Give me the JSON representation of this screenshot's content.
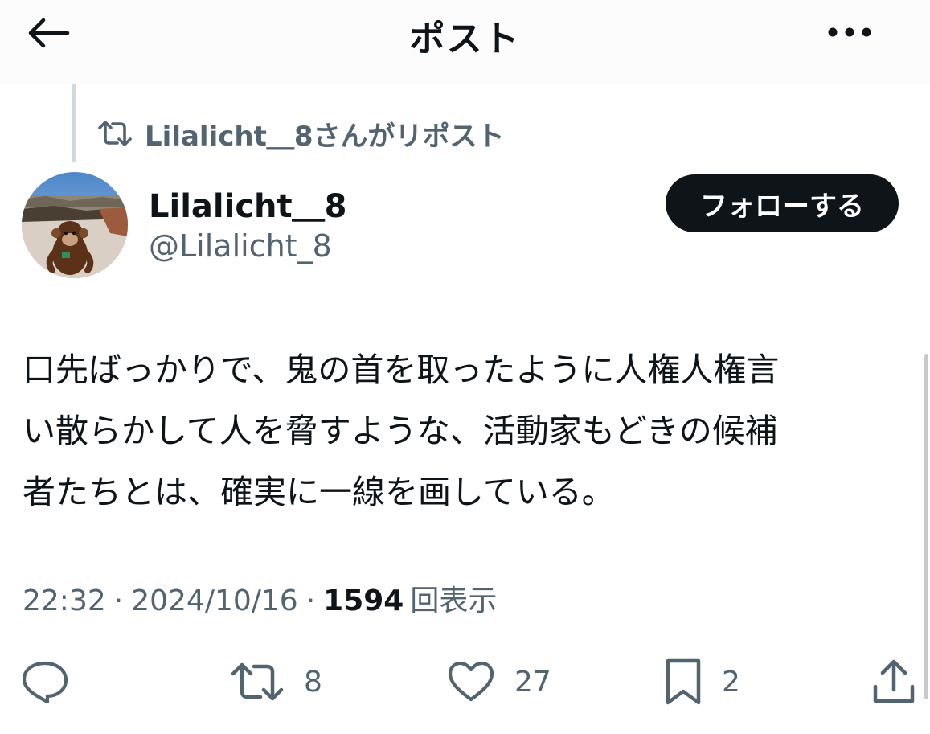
{
  "header": {
    "title": "ポスト",
    "back_icon": "arrow-left-icon",
    "more_icon": "more-horizontal-icon"
  },
  "repost": {
    "icon": "repost-icon",
    "text": "Lilalicht＿8さんがリポスト"
  },
  "author": {
    "display_name": "Lilalicht＿8",
    "handle": "@Lilalicht_8",
    "follow_label": "フォローする"
  },
  "post": {
    "lines": [
      "口先ばっかりで、鬼の首を取ったように人権人権言",
      "い散らかして人を脅すような、活動家もどきの候補",
      "者たちとは、確実に一線を画している。"
    ]
  },
  "meta": {
    "time": "22:32",
    "separator": "·",
    "date": "2024/10/16",
    "views": "1594",
    "views_label": "回表示"
  },
  "actions": {
    "reply": {
      "icon": "reply-icon",
      "count": ""
    },
    "repost": {
      "icon": "repost-icon",
      "count": "8"
    },
    "like": {
      "icon": "heart-icon",
      "count": "27"
    },
    "bookmark": {
      "icon": "bookmark-icon",
      "count": "2"
    },
    "share": {
      "icon": "share-icon",
      "count": ""
    }
  },
  "colors": {
    "text_primary": "#0f1419",
    "text_secondary": "#536471",
    "button_bg": "#0f1419",
    "thread_line": "#cfd9de"
  }
}
